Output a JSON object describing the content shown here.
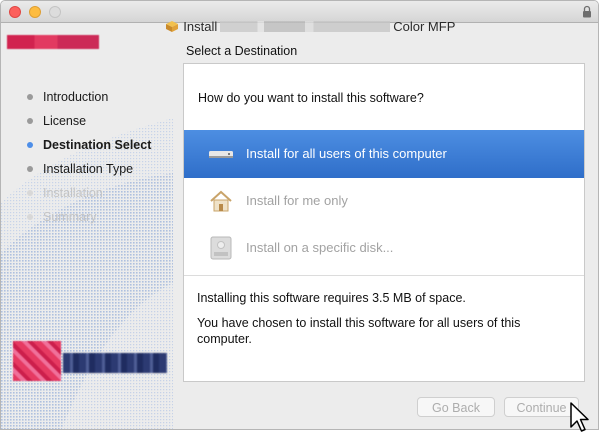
{
  "window": {
    "title_prefix": "Install",
    "title_suffix": "Color MFP",
    "title_blurred_label": "Redacted product name"
  },
  "sidebar": {
    "steps": [
      {
        "label": "Introduction",
        "state": "done"
      },
      {
        "label": "License",
        "state": "done"
      },
      {
        "label": "Destination Select",
        "state": "active"
      },
      {
        "label": "Installation Type",
        "state": "pending"
      },
      {
        "label": "Installation",
        "state": "disabled"
      },
      {
        "label": "Summary",
        "state": "disabled"
      }
    ]
  },
  "main": {
    "heading": "Select a Destination",
    "question": "How do you want to install this software?",
    "options": [
      {
        "label": "Install for all users of this computer",
        "icon": "drive-icon",
        "state": "selected"
      },
      {
        "label": "Install for me only",
        "icon": "home-icon",
        "state": "disabled"
      },
      {
        "label": "Install on a specific disk...",
        "icon": "disk-icon",
        "state": "disabled"
      }
    ],
    "space_info": "Installing this software requires 3.5 MB of space.",
    "choice_info": "You have chosen to install this software for all users of this computer."
  },
  "footer": {
    "back_label": "Go Back",
    "continue_label": "Continue"
  },
  "colors": {
    "selection": "#3a7bd5",
    "active_step_dot": "#4d8ee8",
    "close": "#fc605c",
    "minimize": "#fdbc40"
  }
}
